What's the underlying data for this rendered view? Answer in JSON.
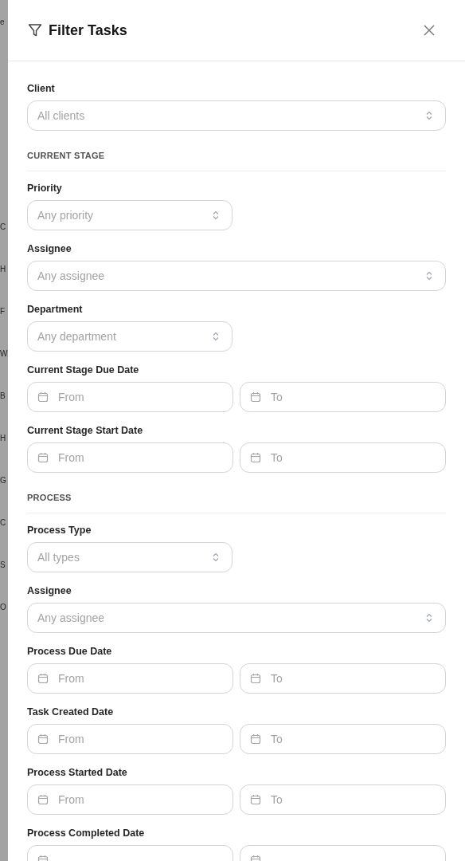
{
  "background_rows": [
    "e",
    "C",
    "H",
    "F",
    "W",
    "B",
    "H",
    "G",
    "C",
    "S",
    "O"
  ],
  "panel": {
    "title": "Filter Tasks",
    "sections": [
      {
        "fields": [
          {
            "kind": "select",
            "label": "Client",
            "placeholder": "All clients",
            "wide": true
          }
        ]
      },
      {
        "heading": "CURRENT STAGE",
        "fields": [
          {
            "kind": "select",
            "label": "Priority",
            "placeholder": "Any priority",
            "wide": false
          },
          {
            "kind": "select",
            "label": "Assignee",
            "placeholder": "Any assignee",
            "wide": true
          },
          {
            "kind": "select",
            "label": "Department",
            "placeholder": "Any department",
            "wide": false
          },
          {
            "kind": "daterange",
            "label": "Current Stage Due Date",
            "from": "From",
            "to": "To"
          },
          {
            "kind": "daterange",
            "label": "Current Stage Start Date",
            "from": "From",
            "to": "To"
          }
        ]
      },
      {
        "heading": "PROCESS",
        "fields": [
          {
            "kind": "select",
            "label": "Process Type",
            "placeholder": "All types",
            "wide": false
          },
          {
            "kind": "select",
            "label": "Assignee",
            "placeholder": "Any assignee",
            "wide": true
          },
          {
            "kind": "daterange",
            "label": "Process Due Date",
            "from": "From",
            "to": "To"
          },
          {
            "kind": "daterange",
            "label": "Task Created Date",
            "from": "From",
            "to": "To"
          },
          {
            "kind": "daterange",
            "label": "Process Started Date",
            "from": "From",
            "to": "To"
          },
          {
            "kind": "daterange",
            "label": "Process Completed Date"
          }
        ]
      }
    ]
  }
}
